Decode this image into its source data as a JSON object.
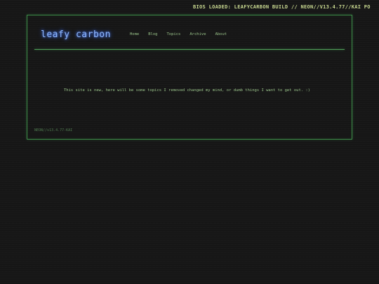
{
  "ticker": {
    "text": "BIOS LOADED: LEAFYCARBON BUILD // NEON//V13.4.77//KAI PO"
  },
  "header": {
    "logo": "leafy carbon",
    "nav": [
      "Home",
      "Blog",
      "Topics",
      "Archive",
      "About"
    ]
  },
  "main": {
    "intro": "This site is new, here will be some topics I removed changed my mind, or dumb things I want to get out. :)"
  },
  "footer": {
    "version": "NEON//v13.4.77-KAI"
  },
  "colors": {
    "background": "#161616",
    "frame_border": "#3f8f4a",
    "logo_glow": "#8fb8ff",
    "nav_text": "#9ac48a",
    "ticker_text": "#c8d890"
  }
}
